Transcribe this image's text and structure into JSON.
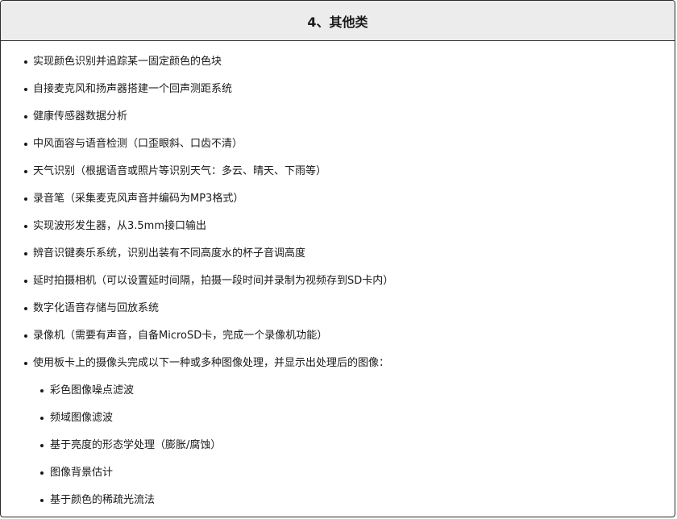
{
  "header": {
    "title": "4、其他类"
  },
  "items": [
    {
      "label": "实现颜色识别并追踪某一固定颜色的色块",
      "level": 1
    },
    {
      "label": "自接麦克风和扬声器搭建一个回声测距系统",
      "level": 1
    },
    {
      "label": "健康传感器数据分析",
      "level": 1
    },
    {
      "label": "中风面容与语音检测（口歪眼斜、口齿不清）",
      "level": 1
    },
    {
      "label": "天气识别（根据语音或照片等识别天气：多云、晴天、下雨等）",
      "level": 1
    },
    {
      "label": "录音笔（采集麦克风声音并编码为MP3格式）",
      "level": 1
    },
    {
      "label": "实现波形发生器，从3.5mm接口输出",
      "level": 1
    },
    {
      "label": "辨音识键奏乐系统，识别出装有不同高度水的杯子音调高度",
      "level": 1
    },
    {
      "label": "延时拍摄相机（可以设置延时间隔，拍摄一段时间并录制为视频存到SD卡内）",
      "level": 1
    },
    {
      "label": "数字化语音存储与回放系统",
      "level": 1
    },
    {
      "label": "录像机（需要有声音，自备MicroSD卡，完成一个录像机功能）",
      "level": 1
    },
    {
      "label": "使用板卡上的摄像头完成以下一种或多种图像处理，并显示出处理后的图像：",
      "level": 1
    },
    {
      "label": "彩色图像噪点滤波",
      "level": 2
    },
    {
      "label": "频域图像滤波",
      "level": 2
    },
    {
      "label": "基于亮度的形态学处理（膨胀/腐蚀）",
      "level": 2
    },
    {
      "label": "图像背景估计",
      "level": 2
    },
    {
      "label": "基于颜色的稀疏光流法",
      "level": 2
    }
  ]
}
